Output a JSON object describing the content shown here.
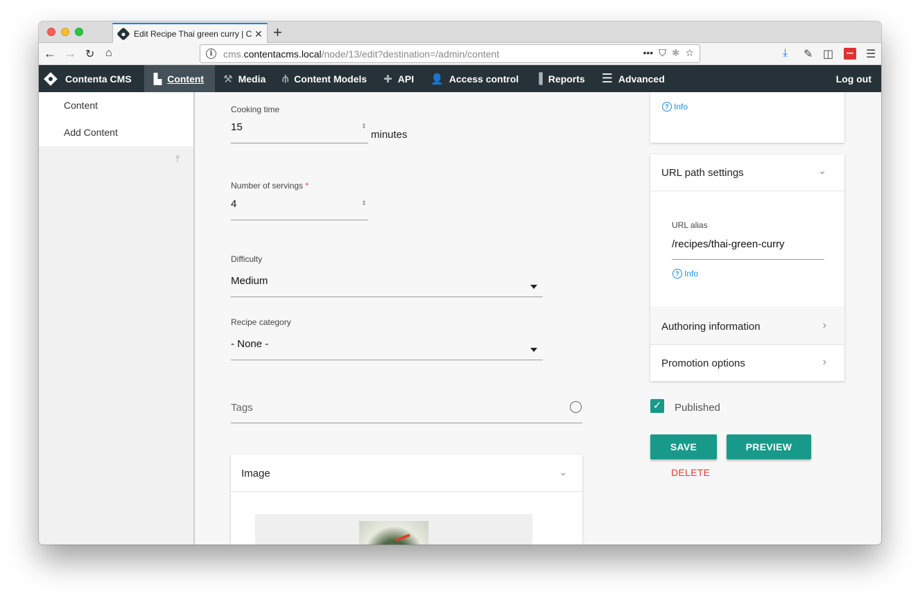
{
  "browser": {
    "tab_title": "Edit Recipe Thai green curry | C",
    "url_host_prefix": "cms.",
    "url_domain": "contentacms.local",
    "url_path": "/node/13/edit?destination=/admin/content"
  },
  "adminbar": {
    "brand": "Contenta CMS",
    "items": [
      {
        "label": "Content"
      },
      {
        "label": "Media"
      },
      {
        "label": "Content Models"
      },
      {
        "label": "API"
      },
      {
        "label": "Access control"
      },
      {
        "label": "Reports"
      },
      {
        "label": "Advanced"
      }
    ],
    "logout": "Log out"
  },
  "sidebar": {
    "items": [
      {
        "label": "Content"
      },
      {
        "label": "Add Content"
      }
    ]
  },
  "form": {
    "cooking_time": {
      "label": "Cooking time",
      "value": "15",
      "suffix": "minutes"
    },
    "servings": {
      "label": "Number of servings",
      "required_mark": "*",
      "value": "4"
    },
    "difficulty": {
      "label": "Difficulty",
      "value": "Medium"
    },
    "category": {
      "label": "Recipe category",
      "value": "- None -"
    },
    "tags": {
      "placeholder": "Tags"
    },
    "image": {
      "title": "Image"
    }
  },
  "sidepanel": {
    "info_top": "Info",
    "url_path_settings": {
      "title": "URL path settings",
      "alias_label": "URL alias",
      "alias_value": "/recipes/thai-green-curry",
      "info": "Info"
    },
    "authoring": "Authoring information",
    "promotion": "Promotion options",
    "published": "Published",
    "save": "SAVE",
    "preview": "PREVIEW",
    "delete": "DELETE"
  },
  "colors": {
    "adminbar_bg": "#263238",
    "accent": "#179a8a",
    "link": "#1f8ee0",
    "danger": "#e53935"
  }
}
